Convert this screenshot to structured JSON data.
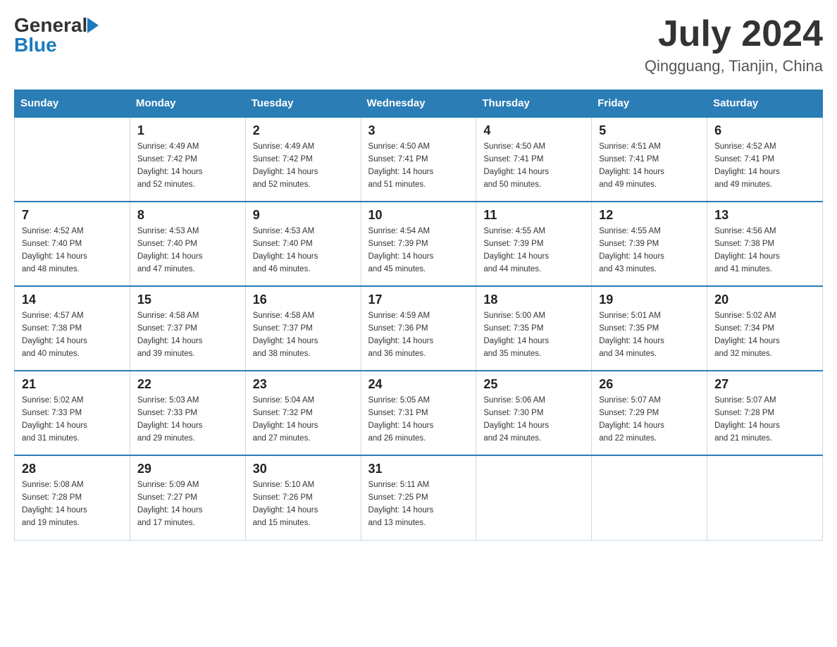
{
  "header": {
    "logo_general": "General",
    "logo_blue": "Blue",
    "month_title": "July 2024",
    "subtitle": "Qingguang, Tianjin, China"
  },
  "days_of_week": [
    "Sunday",
    "Monday",
    "Tuesday",
    "Wednesday",
    "Thursday",
    "Friday",
    "Saturday"
  ],
  "weeks": [
    {
      "days": [
        {
          "num": "",
          "info": ""
        },
        {
          "num": "1",
          "info": "Sunrise: 4:49 AM\nSunset: 7:42 PM\nDaylight: 14 hours\nand 52 minutes."
        },
        {
          "num": "2",
          "info": "Sunrise: 4:49 AM\nSunset: 7:42 PM\nDaylight: 14 hours\nand 52 minutes."
        },
        {
          "num": "3",
          "info": "Sunrise: 4:50 AM\nSunset: 7:41 PM\nDaylight: 14 hours\nand 51 minutes."
        },
        {
          "num": "4",
          "info": "Sunrise: 4:50 AM\nSunset: 7:41 PM\nDaylight: 14 hours\nand 50 minutes."
        },
        {
          "num": "5",
          "info": "Sunrise: 4:51 AM\nSunset: 7:41 PM\nDaylight: 14 hours\nand 49 minutes."
        },
        {
          "num": "6",
          "info": "Sunrise: 4:52 AM\nSunset: 7:41 PM\nDaylight: 14 hours\nand 49 minutes."
        }
      ]
    },
    {
      "days": [
        {
          "num": "7",
          "info": "Sunrise: 4:52 AM\nSunset: 7:40 PM\nDaylight: 14 hours\nand 48 minutes."
        },
        {
          "num": "8",
          "info": "Sunrise: 4:53 AM\nSunset: 7:40 PM\nDaylight: 14 hours\nand 47 minutes."
        },
        {
          "num": "9",
          "info": "Sunrise: 4:53 AM\nSunset: 7:40 PM\nDaylight: 14 hours\nand 46 minutes."
        },
        {
          "num": "10",
          "info": "Sunrise: 4:54 AM\nSunset: 7:39 PM\nDaylight: 14 hours\nand 45 minutes."
        },
        {
          "num": "11",
          "info": "Sunrise: 4:55 AM\nSunset: 7:39 PM\nDaylight: 14 hours\nand 44 minutes."
        },
        {
          "num": "12",
          "info": "Sunrise: 4:55 AM\nSunset: 7:39 PM\nDaylight: 14 hours\nand 43 minutes."
        },
        {
          "num": "13",
          "info": "Sunrise: 4:56 AM\nSunset: 7:38 PM\nDaylight: 14 hours\nand 41 minutes."
        }
      ]
    },
    {
      "days": [
        {
          "num": "14",
          "info": "Sunrise: 4:57 AM\nSunset: 7:38 PM\nDaylight: 14 hours\nand 40 minutes."
        },
        {
          "num": "15",
          "info": "Sunrise: 4:58 AM\nSunset: 7:37 PM\nDaylight: 14 hours\nand 39 minutes."
        },
        {
          "num": "16",
          "info": "Sunrise: 4:58 AM\nSunset: 7:37 PM\nDaylight: 14 hours\nand 38 minutes."
        },
        {
          "num": "17",
          "info": "Sunrise: 4:59 AM\nSunset: 7:36 PM\nDaylight: 14 hours\nand 36 minutes."
        },
        {
          "num": "18",
          "info": "Sunrise: 5:00 AM\nSunset: 7:35 PM\nDaylight: 14 hours\nand 35 minutes."
        },
        {
          "num": "19",
          "info": "Sunrise: 5:01 AM\nSunset: 7:35 PM\nDaylight: 14 hours\nand 34 minutes."
        },
        {
          "num": "20",
          "info": "Sunrise: 5:02 AM\nSunset: 7:34 PM\nDaylight: 14 hours\nand 32 minutes."
        }
      ]
    },
    {
      "days": [
        {
          "num": "21",
          "info": "Sunrise: 5:02 AM\nSunset: 7:33 PM\nDaylight: 14 hours\nand 31 minutes."
        },
        {
          "num": "22",
          "info": "Sunrise: 5:03 AM\nSunset: 7:33 PM\nDaylight: 14 hours\nand 29 minutes."
        },
        {
          "num": "23",
          "info": "Sunrise: 5:04 AM\nSunset: 7:32 PM\nDaylight: 14 hours\nand 27 minutes."
        },
        {
          "num": "24",
          "info": "Sunrise: 5:05 AM\nSunset: 7:31 PM\nDaylight: 14 hours\nand 26 minutes."
        },
        {
          "num": "25",
          "info": "Sunrise: 5:06 AM\nSunset: 7:30 PM\nDaylight: 14 hours\nand 24 minutes."
        },
        {
          "num": "26",
          "info": "Sunrise: 5:07 AM\nSunset: 7:29 PM\nDaylight: 14 hours\nand 22 minutes."
        },
        {
          "num": "27",
          "info": "Sunrise: 5:07 AM\nSunset: 7:28 PM\nDaylight: 14 hours\nand 21 minutes."
        }
      ]
    },
    {
      "days": [
        {
          "num": "28",
          "info": "Sunrise: 5:08 AM\nSunset: 7:28 PM\nDaylight: 14 hours\nand 19 minutes."
        },
        {
          "num": "29",
          "info": "Sunrise: 5:09 AM\nSunset: 7:27 PM\nDaylight: 14 hours\nand 17 minutes."
        },
        {
          "num": "30",
          "info": "Sunrise: 5:10 AM\nSunset: 7:26 PM\nDaylight: 14 hours\nand 15 minutes."
        },
        {
          "num": "31",
          "info": "Sunrise: 5:11 AM\nSunset: 7:25 PM\nDaylight: 14 hours\nand 13 minutes."
        },
        {
          "num": "",
          "info": ""
        },
        {
          "num": "",
          "info": ""
        },
        {
          "num": "",
          "info": ""
        }
      ]
    }
  ]
}
